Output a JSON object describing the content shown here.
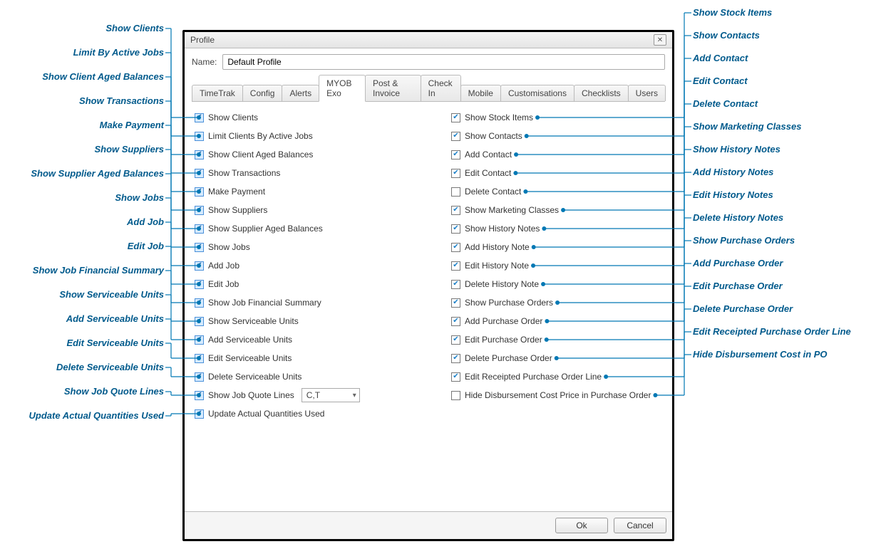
{
  "dialog": {
    "title": "Profile",
    "name_label": "Name:",
    "name_value": "Default Profile",
    "tabs": [
      "TimeTrak",
      "Config",
      "Alerts",
      "MYOB Exo",
      "Post & Invoice",
      "Check In",
      "Mobile",
      "Customisations",
      "Checklists",
      "Users"
    ],
    "active_tab": 3,
    "ok": "Ok",
    "cancel": "Cancel",
    "quote_select": "C,T"
  },
  "left_checks": [
    {
      "label": "Show Clients",
      "checked": true,
      "hl": true
    },
    {
      "label": "Limit Clients By Active Jobs",
      "checked": false,
      "hl": true
    },
    {
      "label": "Show Client Aged Balances",
      "checked": true,
      "hl": true
    },
    {
      "label": "Show Transactions",
      "checked": true,
      "hl": true
    },
    {
      "label": "Make Payment",
      "checked": true,
      "hl": true
    },
    {
      "label": "Show Suppliers",
      "checked": true,
      "hl": true
    },
    {
      "label": "Show Supplier Aged Balances",
      "checked": true,
      "hl": true
    },
    {
      "label": "Show Jobs",
      "checked": true,
      "hl": true
    },
    {
      "label": "Add Job",
      "checked": true,
      "hl": true
    },
    {
      "label": "Edit Job",
      "checked": true,
      "hl": true
    },
    {
      "label": "Show Job Financial Summary",
      "checked": true,
      "hl": true
    },
    {
      "label": "Show Serviceable Units",
      "checked": true,
      "hl": true
    },
    {
      "label": "Add Serviceable Units",
      "checked": true,
      "hl": true
    },
    {
      "label": "Edit Serviceable Units",
      "checked": true,
      "hl": true
    },
    {
      "label": "Delete Serviceable Units",
      "checked": true,
      "hl": true
    },
    {
      "label": "Show Job Quote Lines",
      "checked": true,
      "hl": true,
      "select": true
    },
    {
      "label": "Update Actual Quantities Used",
      "checked": true,
      "hl": true
    }
  ],
  "right_checks": [
    {
      "label": "Show Stock Items",
      "checked": true
    },
    {
      "label": "Show Contacts",
      "checked": true
    },
    {
      "label": "Add Contact",
      "checked": true
    },
    {
      "label": "Edit Contact",
      "checked": true
    },
    {
      "label": "Delete Contact",
      "checked": false
    },
    {
      "label": "Show Marketing Classes",
      "checked": true
    },
    {
      "label": "Show History Notes",
      "checked": true
    },
    {
      "label": "Add History Note",
      "checked": true
    },
    {
      "label": "Edit History Note",
      "checked": true
    },
    {
      "label": "Delete History Note",
      "checked": true
    },
    {
      "label": "Show Purchase Orders",
      "checked": true
    },
    {
      "label": "Add Purchase Order",
      "checked": true
    },
    {
      "label": "Edit Purchase Order",
      "checked": true
    },
    {
      "label": "Delete Purchase Order",
      "checked": true
    },
    {
      "label": "Edit Receipted Purchase Order Line",
      "checked": true
    },
    {
      "label": "Hide Disbursement Cost Price in Purchase Order",
      "checked": false
    }
  ],
  "anno_left": [
    "Show Clients",
    "Limit By Active Jobs",
    "Show Client Aged Balances",
    "Show Transactions",
    "Make Payment",
    "Show Suppliers",
    "Show Supplier Aged Balances",
    "Show Jobs",
    "Add Job",
    "Edit Job",
    "Show Job Financial Summary",
    "Show Serviceable Units",
    "Add Serviceable Units",
    "Edit Serviceable Units",
    "Delete Serviceable Units",
    "Show Job Quote Lines",
    "Update Actual Quantities Used"
  ],
  "anno_right": [
    "Show Stock Items",
    "Show Contacts",
    "Add Contact",
    "Edit Contact",
    "Delete Contact",
    "Show Marketing Classes",
    "Show History Notes",
    "Add History Notes",
    "Edit History Notes",
    "Delete History Notes",
    "Show Purchase Orders",
    "Add Purchase Order",
    "Edit Purchase Order",
    "Delete Purchase Order",
    "Edit Receipted Purchase Order Line",
    "Hide Disbursement Cost in PO"
  ]
}
